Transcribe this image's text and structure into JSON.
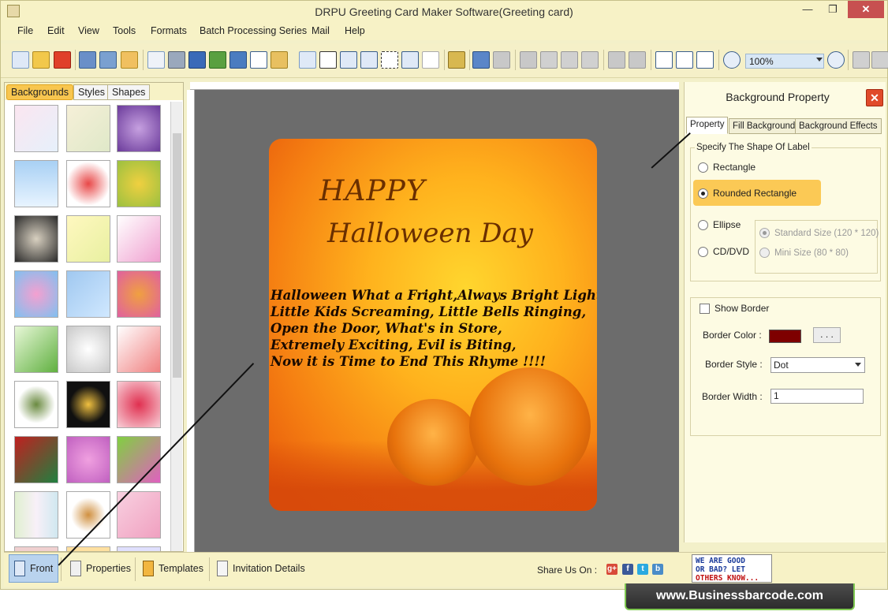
{
  "window": {
    "title": "DRPU Greeting Card Maker Software(Greeting card)",
    "minimize": "—",
    "restore": "❐",
    "close": "✕"
  },
  "menu": [
    "File",
    "Edit",
    "View",
    "Tools",
    "Formats",
    "Batch Processing Series",
    "Mail",
    "Help"
  ],
  "toolbar": {
    "zoom_value": "100%"
  },
  "left_panel": {
    "tabs": [
      "Backgrounds",
      "Styles",
      "Shapes"
    ],
    "active_tab": "Backgrounds"
  },
  "card": {
    "title_line1": "HAPPY",
    "title_line2": "Halloween Day",
    "verse": [
      "Halloween What a Fright,Always Bright Light",
      "Little Kids Screaming, Little Bells Ringing,",
      "Open the Door, What's in Store,",
      "Extremely Exciting, Evil is Biting,",
      "Now it is Time to End This Rhyme !!!!"
    ]
  },
  "right_panel": {
    "title": "Background Property",
    "close": "✕",
    "tabs": [
      "Property",
      "Fill Background",
      "Background Effects"
    ],
    "active_tab": "Property",
    "shape_group_title": "Specify The Shape Of Label",
    "shapes": [
      "Rectangle",
      "Rounded Rectangle",
      "Ellipse",
      "CD/DVD"
    ],
    "selected_shape": "Rounded Rectangle",
    "sizes": [
      "Standard Size (120 * 120)",
      "Mini Size (80 * 80)"
    ],
    "selected_size": "Standard Size (120 * 120)",
    "show_border_label": "Show Border",
    "show_border_checked": false,
    "border_color_label": "Border Color :",
    "border_color": "#7e0000",
    "border_color_button": ". . .",
    "border_style_label": "Border Style :",
    "border_style_value": "Dot",
    "border_width_label": "Border Width :",
    "border_width_value": "1"
  },
  "bottom_bar": {
    "buttons": [
      "Front",
      "Properties",
      "Templates",
      "Invitation Details"
    ],
    "active": "Front",
    "share_label": "Share Us On :",
    "social": [
      "g+",
      "f",
      "t",
      "b"
    ]
  },
  "badge": {
    "lines": [
      "WE ARE GOOD",
      "OR BAD? LET",
      "OTHERS KNOW..."
    ]
  },
  "site_banner": "www.Businessbarcode.com"
}
